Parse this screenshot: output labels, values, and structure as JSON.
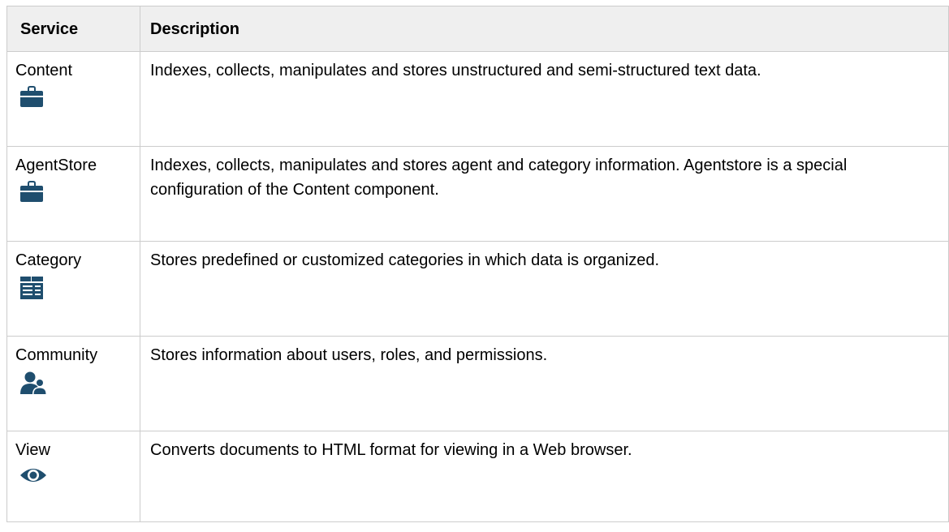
{
  "table": {
    "headers": {
      "service": "Service",
      "description": "Description"
    },
    "rows": [
      {
        "service": "Content",
        "icon": "briefcase-icon",
        "description": "Indexes, collects, manipulates and stores unstructured and semi-structured text data."
      },
      {
        "service": "AgentStore",
        "icon": "briefcase-icon",
        "description": "Indexes, collects, manipulates and stores agent and category information. Agentstore is a special configuration of the Content component."
      },
      {
        "service": "Category",
        "icon": "category-list-icon",
        "description": "Stores predefined or customized categories in which data is organized."
      },
      {
        "service": "Community",
        "icon": "users-icon",
        "description": "Stores information about users, roles, and permissions."
      },
      {
        "service": "View",
        "icon": "eye-icon",
        "description": "Converts documents to HTML format for viewing in a Web browser."
      }
    ]
  },
  "colors": {
    "icon": "#1f4e6e",
    "header_background": "#efefef",
    "grid": "#cccccc"
  }
}
